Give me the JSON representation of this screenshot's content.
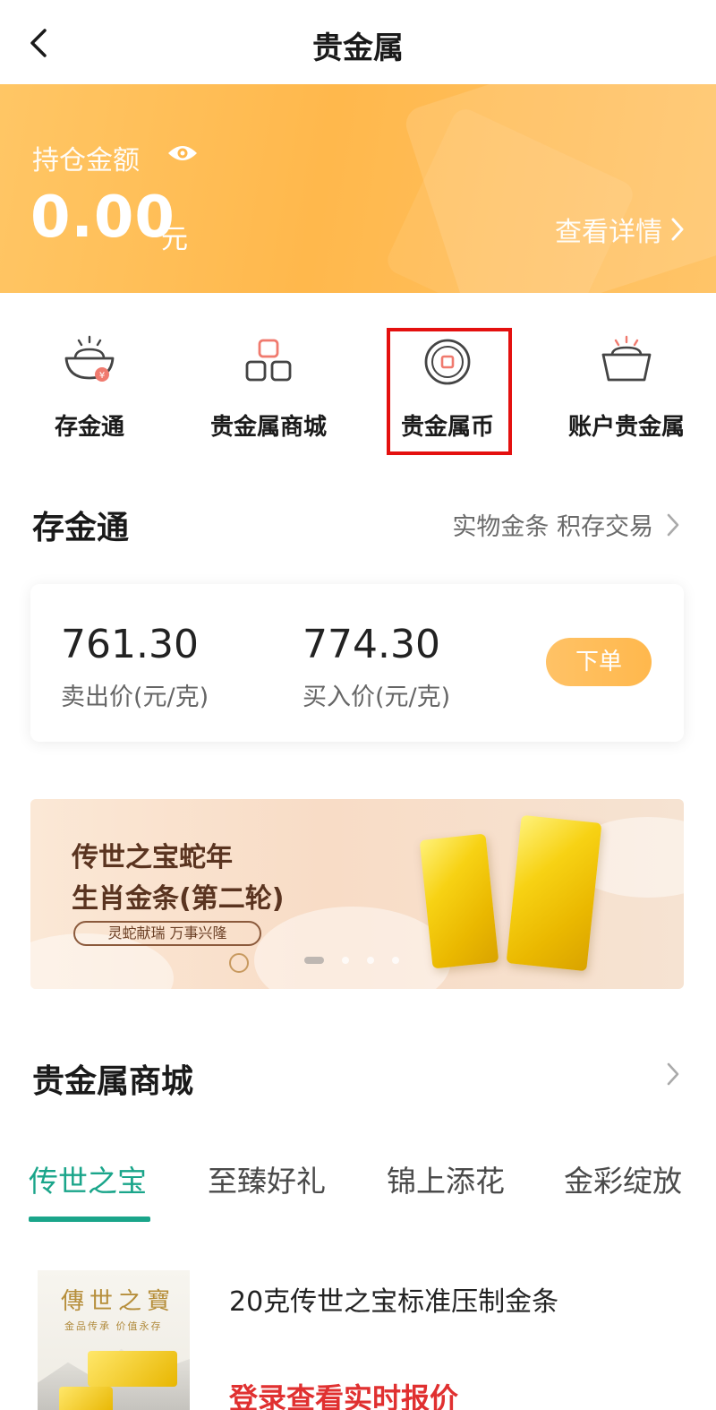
{
  "header": {
    "title": "贵金属"
  },
  "holdings": {
    "label": "持仓金额",
    "amount": "0.00",
    "unit": "元",
    "detail_link": "查看详情"
  },
  "quick_nav": [
    {
      "label": "存金通",
      "icon": "gold-ingot-icon"
    },
    {
      "label": "贵金属商城",
      "icon": "mall-blocks-icon"
    },
    {
      "label": "贵金属币",
      "icon": "coin-icon",
      "highlighted": true
    },
    {
      "label": "账户贵金属",
      "icon": "gold-bowl-icon"
    }
  ],
  "cunjintong": {
    "title": "存金通",
    "more": "实物金条 积存交易",
    "sell_price": "761.30",
    "sell_label": "卖出价(元/克)",
    "buy_price": "774.30",
    "buy_label": "买入价(元/克)",
    "order_button": "下单"
  },
  "promo": {
    "line1": "传世之宝蛇年",
    "line2": "生肖金条(第二轮)",
    "tagline": "灵蛇献瑞 万事兴隆",
    "carousel_count": 4,
    "carousel_active": 1
  },
  "mall": {
    "title": "贵金属商城",
    "tabs": [
      "传世之宝",
      "至臻好礼",
      "锦上添花",
      "金彩绽放"
    ],
    "active_tab": 0,
    "product": {
      "image_title": "傳世之寶",
      "image_subtitle": "金品传承 价值永存",
      "name": "20克传世之宝标准压制金条",
      "price_text": "登录查看实时报价"
    }
  },
  "colors": {
    "banner_orange": "#ffb84c",
    "accent_green": "#1aa58a",
    "price_red": "#e03030",
    "highlight_red": "#e4100f"
  }
}
